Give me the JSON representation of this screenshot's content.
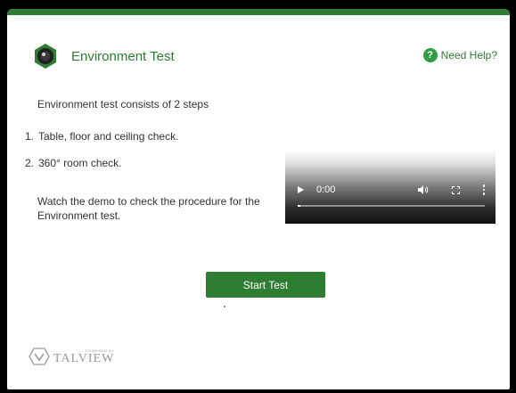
{
  "header": {
    "title": "Environment Test",
    "logo_icon": "camera-lens-icon",
    "help_label": "Need Help?",
    "help_icon": "question-circle-icon"
  },
  "content": {
    "intro": "Environment test consists of 2 steps",
    "steps": [
      {
        "num": "1.",
        "text": "Table, floor and ceiling check."
      },
      {
        "num": "2.",
        "text": "360° room check."
      }
    ],
    "demo_text": "Watch the demo to check the procedure for the Environment test."
  },
  "video": {
    "time": "0:00",
    "progress": 0
  },
  "actions": {
    "start_label": "Start Test"
  },
  "footer": {
    "powered_by": "POWERED BY",
    "brand_name": "TALVIEW"
  },
  "colors": {
    "accent": "#2e7d32",
    "help_icon": "#2e9e44",
    "text": "#333333"
  }
}
